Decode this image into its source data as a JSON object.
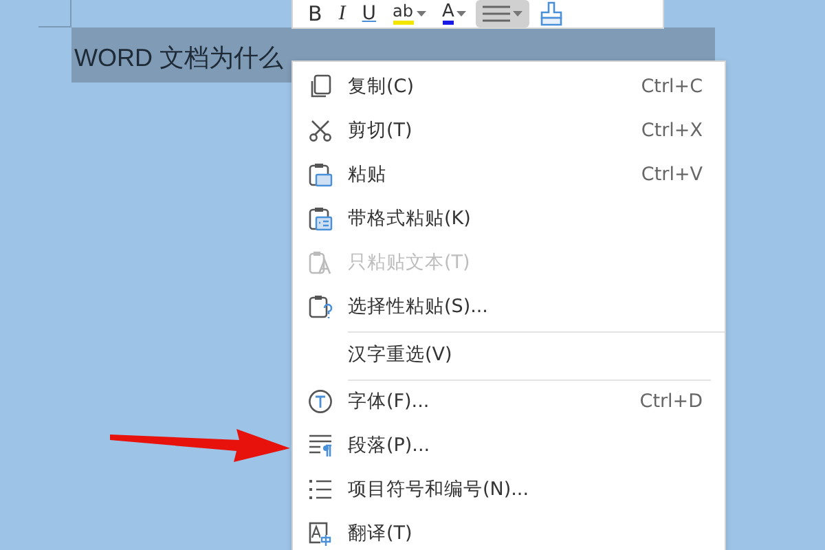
{
  "document": {
    "selected_text": "WORD 文档为什么",
    "selected": true
  },
  "toolbar": {
    "buttons": [
      {
        "kind": "bold",
        "label": "B",
        "selected": false
      },
      {
        "kind": "italic",
        "label": "I",
        "selected": false
      },
      {
        "kind": "underline",
        "label": "U",
        "selected": false
      },
      {
        "kind": "highlight",
        "label": "ab",
        "selected": false
      },
      {
        "kind": "font_color",
        "label": "A",
        "selected": false
      },
      {
        "kind": "align",
        "selected": true
      },
      {
        "kind": "format_painter",
        "selected": false
      }
    ]
  },
  "context_menu": {
    "items": [
      {
        "kind": "copy",
        "label": "复制(C)",
        "shortcut": "Ctrl+C",
        "disabled": false,
        "separator_above": false
      },
      {
        "kind": "cut",
        "label": "剪切(T)",
        "shortcut": "Ctrl+X",
        "disabled": false,
        "separator_above": false
      },
      {
        "kind": "paste",
        "label": "粘贴",
        "shortcut": "Ctrl+V",
        "disabled": false,
        "separator_above": false
      },
      {
        "kind": "paste_format",
        "label": "带格式粘贴(K)",
        "disabled": false,
        "separator_above": false
      },
      {
        "kind": "paste_text",
        "label": "只粘贴文本(T)",
        "disabled": true,
        "separator_above": false
      },
      {
        "kind": "paste_special",
        "label": "选择性粘贴(S)...",
        "disabled": false,
        "separator_above": false
      },
      {
        "kind": "none",
        "label": "汉字重选(V)",
        "disabled": false,
        "separator_above": true
      },
      {
        "kind": "font",
        "label": "字体(F)...",
        "shortcut": "Ctrl+D",
        "disabled": false,
        "separator_above": true
      },
      {
        "kind": "paragraph",
        "label": "段落(P)...",
        "disabled": false,
        "separator_above": false
      },
      {
        "kind": "bullets",
        "label": "项目符号和编号(N)...",
        "disabled": false,
        "separator_above": false
      },
      {
        "kind": "translate",
        "label": "翻译(T)",
        "disabled": false,
        "separator_above": false
      }
    ]
  }
}
